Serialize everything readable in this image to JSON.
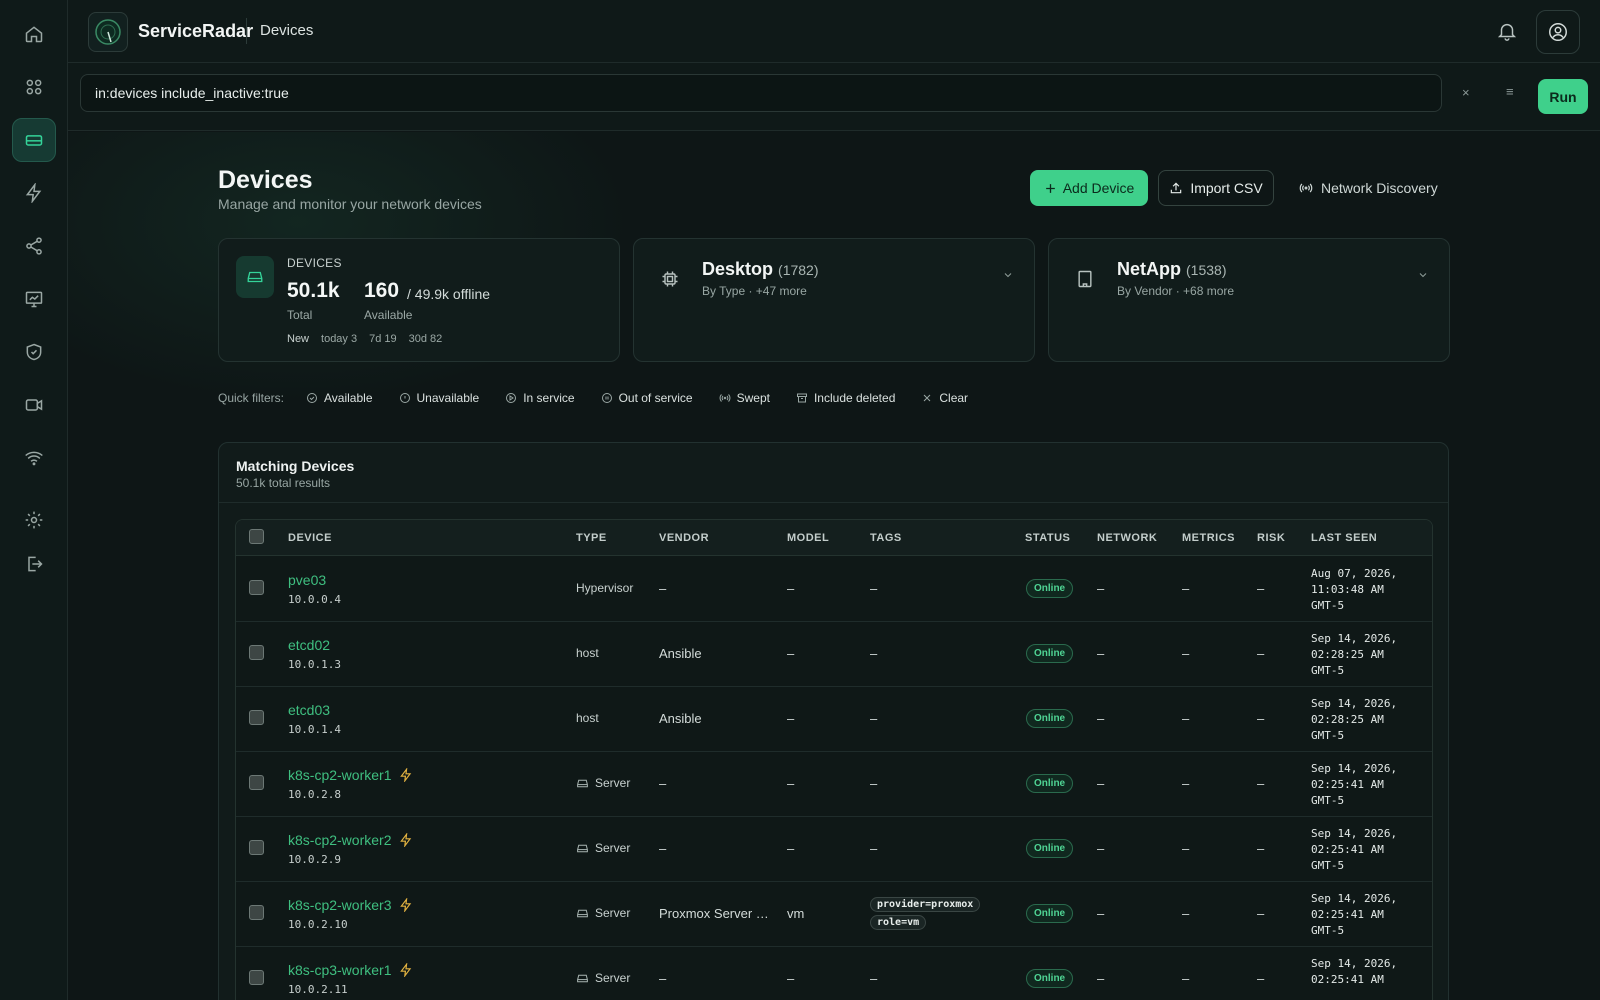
{
  "app": {
    "name": "ServiceRadar",
    "breadcrumb": "Devices"
  },
  "query": {
    "value": "in:devices include_inactive:true",
    "clear_label": "×",
    "filter_label": "≡",
    "run_label": "Run"
  },
  "header": {
    "title": "Devices",
    "subtitle": "Manage and monitor your network devices",
    "add_label": "Add Device",
    "import_label": "Import CSV",
    "discovery_label": "Network Discovery"
  },
  "stats": {
    "label": "DEVICES",
    "total": "50.1k",
    "total_label": "Total",
    "available": "160",
    "offline": "/ 49.9k offline",
    "available_label": "Available",
    "new_label": "New",
    "today": "today 3",
    "d7": "7d 19",
    "d30": "30d 82"
  },
  "type_summary": {
    "title": "Desktop",
    "count": "(1782)",
    "sub": "By Type · +47 more"
  },
  "vendor_summary": {
    "title": "NetApp",
    "count": "(1538)",
    "sub": "By Vendor · +68 more"
  },
  "quick_filters": {
    "label": "Quick filters:",
    "items": [
      "Available",
      "Unavailable",
      "In service",
      "Out of service",
      "Swept",
      "Include deleted",
      "Clear"
    ]
  },
  "panel": {
    "title": "Matching Devices",
    "subtitle": "50.1k total results"
  },
  "columns": [
    "DEVICE",
    "TYPE",
    "VENDOR",
    "MODEL",
    "TAGS",
    "STATUS",
    "NETWORK",
    "METRICS",
    "RISK",
    "LAST SEEN"
  ],
  "rows": [
    {
      "name": "pve03",
      "ip": "10.0.0.4",
      "type": "Hypervisor",
      "vendor": "–",
      "model": "–",
      "tags": "–",
      "status": "Online",
      "network": "–",
      "metrics": "–",
      "risk": "–",
      "last_seen": "Aug 07, 2026,\n11:03:48 AM\nGMT-5"
    },
    {
      "name": "etcd02",
      "ip": "10.0.1.3",
      "type": "host",
      "vendor": "Ansible",
      "model": "–",
      "tags": "–",
      "status": "Online",
      "network": "–",
      "metrics": "–",
      "risk": "–",
      "last_seen": "Sep 14, 2026,\n02:28:25 AM\nGMT-5"
    },
    {
      "name": "etcd03",
      "ip": "10.0.1.4",
      "type": "host",
      "vendor": "Ansible",
      "model": "–",
      "tags": "–",
      "status": "Online",
      "network": "–",
      "metrics": "–",
      "risk": "–",
      "last_seen": "Sep 14, 2026,\n02:28:25 AM\nGMT-5"
    },
    {
      "name": "k8s-cp2-worker1",
      "ip": "10.0.2.8",
      "type": "Server",
      "vendor": "–",
      "model": "–",
      "tags": "–",
      "status": "Online",
      "network": "–",
      "metrics": "–",
      "risk": "–",
      "last_seen": "Sep 14, 2026,\n02:25:41 AM\nGMT-5"
    },
    {
      "name": "k8s-cp2-worker2",
      "ip": "10.0.2.9",
      "type": "Server",
      "vendor": "–",
      "model": "–",
      "tags": "–",
      "status": "Online",
      "network": "–",
      "metrics": "–",
      "risk": "–",
      "last_seen": "Sep 14, 2026,\n02:25:41 AM\nGMT-5"
    },
    {
      "name": "k8s-cp2-worker3",
      "ip": "10.0.2.10",
      "type": "Server",
      "vendor": "Proxmox Server …",
      "model": "vm",
      "tag1": "provider=proxmox",
      "tag2": "role=vm",
      "status": "Online",
      "network": "–",
      "metrics": "–",
      "risk": "–",
      "last_seen": "Sep 14, 2026,\n02:25:41 AM\nGMT-5"
    },
    {
      "name": "k8s-cp3-worker1",
      "ip": "10.0.2.11",
      "type": "Server",
      "vendor": "–",
      "model": "–",
      "tags": "–",
      "status": "Online",
      "network": "–",
      "metrics": "–",
      "risk": "–",
      "last_seen": "Sep 14, 2026,\n02:25:41 AM"
    }
  ],
  "colors": {
    "accent": "#3fd08b",
    "link": "#3fbf80",
    "bg": "#0e1616",
    "bolt": "#e3b341"
  },
  "icons": [
    "home-icon",
    "grid-icon",
    "devices-icon",
    "bolt-icon",
    "share-icon",
    "chart-icon",
    "shield-icon",
    "video-icon",
    "wifi-icon",
    "gear-icon",
    "logout-icon",
    "bell-icon",
    "user-icon"
  ]
}
